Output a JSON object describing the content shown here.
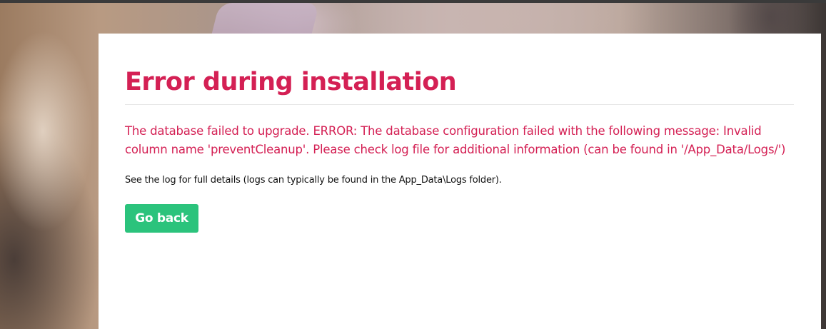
{
  "error": {
    "title": "Error during installation",
    "message": "The database failed to upgrade. ERROR: The database configuration failed with the following message: Invalid column name 'preventCleanup'. Please check log file for additional information (can be found in '/App_Data/Logs/')",
    "hint": "See the log for full details (logs can typically be found in the App_Data\\Logs folder).",
    "button_label": "Go back"
  },
  "colors": {
    "accent": "#d42054",
    "button": "#2bc37c",
    "panel": "#ffffff"
  }
}
